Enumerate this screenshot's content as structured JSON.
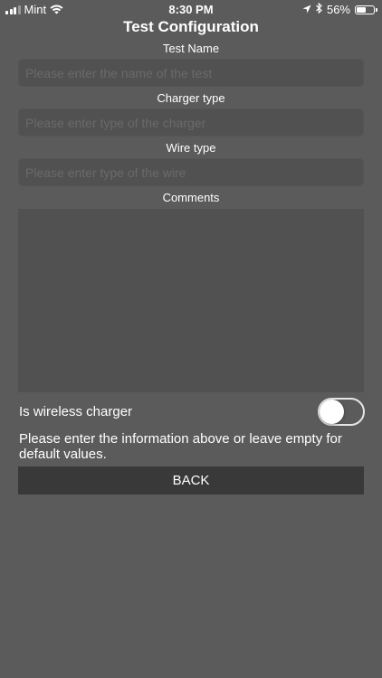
{
  "status_bar": {
    "carrier": "Mint",
    "time": "8:30 PM",
    "battery_text": "56%",
    "battery_level": 0.56,
    "icons": [
      "signal-icon",
      "wifi-icon",
      "location-arrow-icon",
      "bluetooth-icon",
      "battery-icon"
    ]
  },
  "title": "Test Configuration",
  "fields": [
    {
      "label": "Test Name",
      "placeholder": "Please enter the name of the test",
      "value": ""
    },
    {
      "label": "Charger type",
      "placeholder": "Please enter type of the charger",
      "value": ""
    },
    {
      "label": "Wire type",
      "placeholder": "Please enter type of the wire",
      "value": ""
    }
  ],
  "comments": {
    "label": "Comments",
    "value": ""
  },
  "wireless": {
    "label": "Is wireless charger",
    "enabled": false
  },
  "info_text": "Please enter the information above or leave empty for default values.",
  "back_button": "BACK"
}
